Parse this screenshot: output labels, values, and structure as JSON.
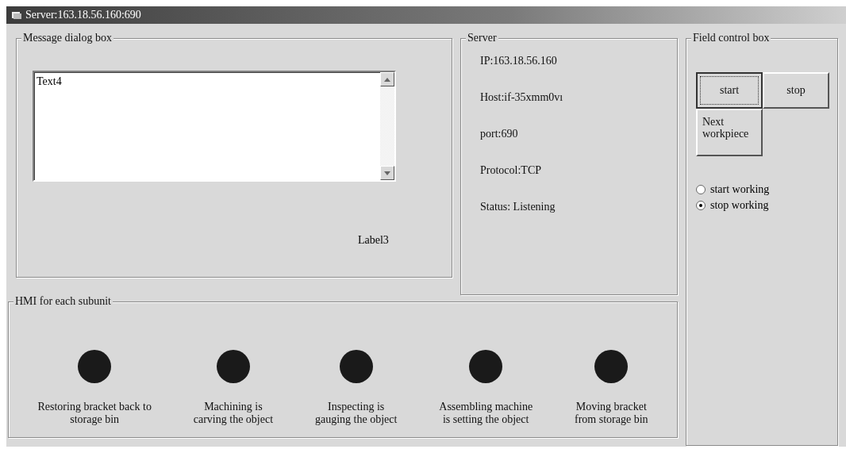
{
  "window": {
    "title": "Server:163.18.56.160:690"
  },
  "message_box": {
    "title": "Message dialog box",
    "text": "Text4",
    "label": "Label3"
  },
  "server": {
    "title": "Server",
    "lines": [
      "IP:163.18.56.160",
      "Host:if-35xmm0vı",
      "port:690",
      "Protocol:TCP",
      "Status: Listening"
    ]
  },
  "field_control": {
    "title": "Field control box",
    "buttons": [
      {
        "label": "start",
        "focused": true
      },
      {
        "label": "stop",
        "focused": false
      },
      {
        "label": "Next\nworkpiece",
        "focused": false
      }
    ],
    "radios": [
      {
        "label": "start  working",
        "selected": false
      },
      {
        "label": "stop working",
        "selected": true
      }
    ]
  },
  "hmi": {
    "title": "HMI for each subunit",
    "units": [
      {
        "label": "Restoring bracket back to\nstorage bin",
        "color": "#1a1a1a"
      },
      {
        "label": "Machining is\ncarving the object",
        "color": "#1a1a1a"
      },
      {
        "label": "Inspecting is\ngauging the object",
        "color": "#1a1a1a"
      },
      {
        "label": "Assembling machine\nis setting the object",
        "color": "#1a1a1a"
      },
      {
        "label": "Moving bracket\nfrom storage bin",
        "color": "#1a1a1a"
      }
    ]
  }
}
